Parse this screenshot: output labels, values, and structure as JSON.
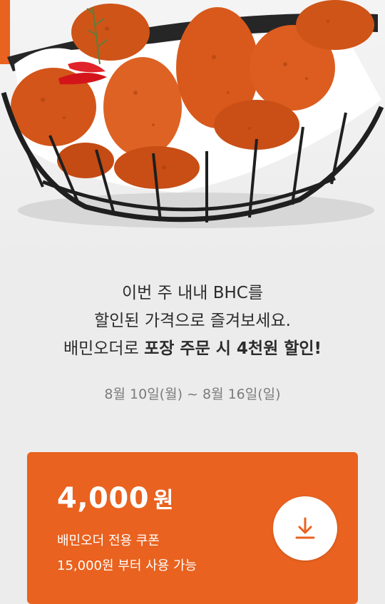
{
  "hero": {
    "image": "fried-chicken-basket",
    "colors": {
      "chicken": "#d85a1e",
      "basket_wire": "#1f1f1f",
      "paper": "#ffffff"
    }
  },
  "promo": {
    "line1": "이번 주 내내 BHC를",
    "line2": "할인된 가격으로 즐겨보세요.",
    "line3_prefix": "배민오더로 ",
    "line3_emphasis": "포장 주문 시 4천원 할인!",
    "period": "8월 10일(월) ~ 8월 16일(일)"
  },
  "coupon": {
    "amount": "4,000",
    "unit": "원",
    "type_label": "배민오더 전용 쿠폰",
    "min_order": "15,000원 부터 사용 가능",
    "download_icon": "download-icon",
    "colors": {
      "background": "#e9621f",
      "text": "#ffffff",
      "button": "#ffffff",
      "icon": "#e9621f"
    }
  }
}
